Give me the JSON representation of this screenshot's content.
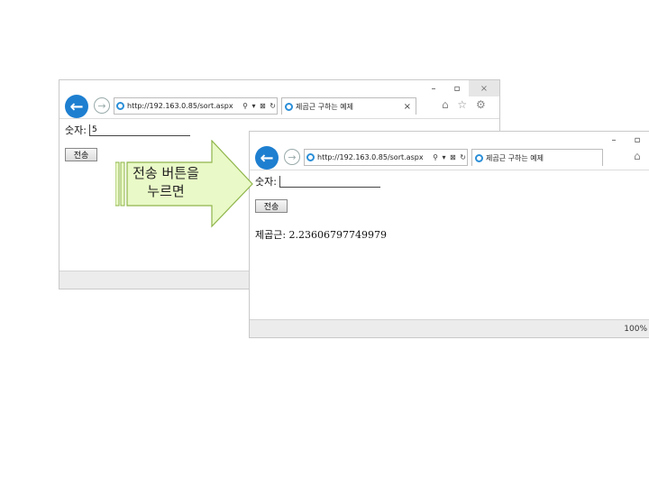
{
  "window1": {
    "caption": {
      "minimize": "–",
      "maximize": "▫",
      "close": "×"
    },
    "address_url": "http://192.163.0.85/sort.aspx",
    "address_icons": "⚲ ▾ ⊠ ↻",
    "tab_title": "제곱근 구하는 예제",
    "tab_close": "×",
    "right_icons": "⌂ ☆ ⚙",
    "label": "숫자:",
    "input_value": "5",
    "button": "전송",
    "status": ""
  },
  "window2": {
    "caption": {
      "minimize": "–",
      "maximize": "▫"
    },
    "address_url": "http://192.163.0.85/sort.aspx",
    "address_icons": "⚲ ▾ ⊠ ↻",
    "tab_title": "제곱근 구하는 예제",
    "right_icons": "⌂",
    "label": "숫자:",
    "input_value": "",
    "button": "전송",
    "result": "제곱근: 2.23606797749979",
    "zoom": "100%"
  },
  "callout": {
    "line1": "전송 버튼을",
    "line2": "누르면"
  },
  "colors": {
    "callout_fill": "#e9f9c7",
    "callout_stroke": "#8fb54a",
    "ie_blue": "#1e7fd0"
  }
}
